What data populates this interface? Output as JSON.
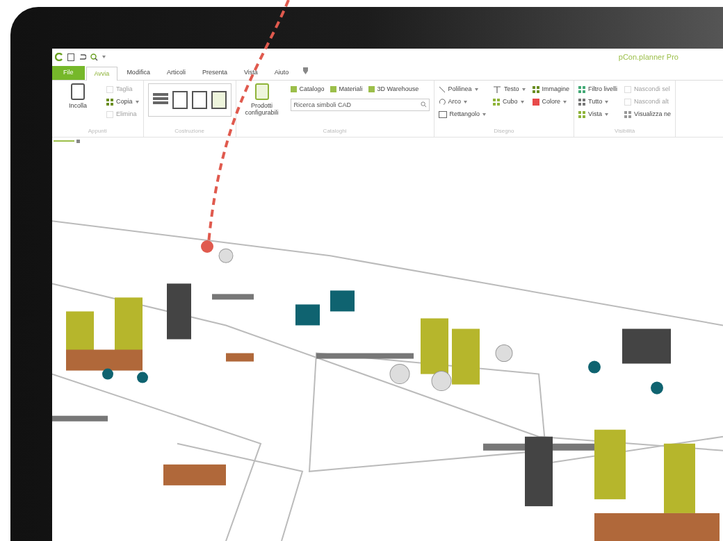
{
  "window": {
    "title": "pCon.planner Pro"
  },
  "tabs": [
    {
      "label": "File",
      "selected": false,
      "kind": "file"
    },
    {
      "label": "Avvia",
      "selected": true,
      "kind": "tab"
    },
    {
      "label": "Modifica",
      "selected": false,
      "kind": "tab"
    },
    {
      "label": "Articoli",
      "selected": false,
      "kind": "tab"
    },
    {
      "label": "Presenta",
      "selected": false,
      "kind": "tab"
    },
    {
      "label": "Vista",
      "selected": false,
      "kind": "tab"
    },
    {
      "label": "Aiuto",
      "selected": false,
      "kind": "tab"
    }
  ],
  "ribbon": {
    "groups": [
      {
        "label": "Appunti",
        "big": {
          "label": "Incolla"
        },
        "columns": [
          [
            {
              "label": "Taglia",
              "disabled": true,
              "dropdown": false
            },
            {
              "label": "Copia",
              "disabled": false,
              "dropdown": true
            },
            {
              "label": "Elimina",
              "disabled": true,
              "dropdown": false
            }
          ]
        ]
      },
      {
        "label": "Costruzione"
      },
      {
        "label": "Cataloghi",
        "big": {
          "label": "Prodotti configurabili"
        },
        "row": [
          {
            "label": "Catalogo"
          },
          {
            "label": "Materiali"
          },
          {
            "label": "3D Warehouse"
          }
        ],
        "search": {
          "placeholder": "Ricerca simboli CAD"
        }
      },
      {
        "label": "Disegno",
        "columns": [
          [
            {
              "label": "Polilinea",
              "disabled": false,
              "dropdown": true
            },
            {
              "label": "Arco",
              "disabled": false,
              "dropdown": true
            },
            {
              "label": "Rettangolo",
              "disabled": false,
              "dropdown": true
            }
          ],
          [
            {
              "label": "Testo",
              "disabled": false,
              "dropdown": true
            },
            {
              "label": "Cubo",
              "disabled": false,
              "dropdown": true
            }
          ],
          [
            {
              "label": "Immagine",
              "disabled": false,
              "dropdown": false
            },
            {
              "label": "Colore",
              "disabled": false,
              "dropdown": true
            }
          ]
        ]
      },
      {
        "label": "Visibilità",
        "columns": [
          [
            {
              "label": "Filtro livelli",
              "disabled": false,
              "dropdown": false
            },
            {
              "label": "Tutto",
              "disabled": false,
              "dropdown": true
            },
            {
              "label": "Vista",
              "disabled": false,
              "dropdown": true
            }
          ],
          [
            {
              "label": "Nascondi sel",
              "disabled": true,
              "dropdown": false
            },
            {
              "label": "Nascondi alt",
              "disabled": true,
              "dropdown": false
            },
            {
              "label": "Visualizza ne",
              "disabled": false,
              "dropdown": false
            }
          ]
        ]
      }
    ]
  }
}
